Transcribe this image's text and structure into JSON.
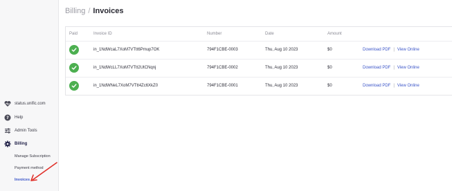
{
  "breadcrumb": {
    "parent": "Billing",
    "separator": "/",
    "current": "Invoices"
  },
  "sidebar": {
    "items": [
      {
        "label": "status.unific.com",
        "icon": "heart-pulse-icon"
      },
      {
        "label": "Help",
        "icon": "help-icon"
      },
      {
        "label": "Admin Tools",
        "icon": "sliders-icon"
      },
      {
        "label": "Billing",
        "icon": "gear-icon"
      }
    ],
    "billing_sub": [
      "Manage Subscription",
      "Payment method",
      "Invoices"
    ]
  },
  "table": {
    "headers": [
      "Paid",
      "Invoice ID",
      "Number",
      "Date",
      "Amount"
    ],
    "rows": [
      {
        "invoice_id": "in_1NdWcaL7XoM7VTtt6Pmup7OK",
        "number": "794F1CBE-0003",
        "date": "Thu, Aug 10 2023",
        "amount": "$0"
      },
      {
        "invoice_id": "in_1NdWcLL7XoM7VTtt2UtCNqnj",
        "number": "794F1CBE-0002",
        "date": "Thu, Aug 10 2023",
        "amount": "$0"
      },
      {
        "invoice_id": "in_1NdWNeL7XoM7VTtt4Zc6XkZ0",
        "number": "794F1CBE-0001",
        "date": "Thu, Aug 10 2023",
        "amount": "$0"
      }
    ],
    "actions": {
      "download": "Download PDF",
      "divider": "|",
      "view": "View Online"
    }
  },
  "colors": {
    "accent": "#3a54c8",
    "paid": "#4caf50",
    "arrow": "#e0302a"
  }
}
